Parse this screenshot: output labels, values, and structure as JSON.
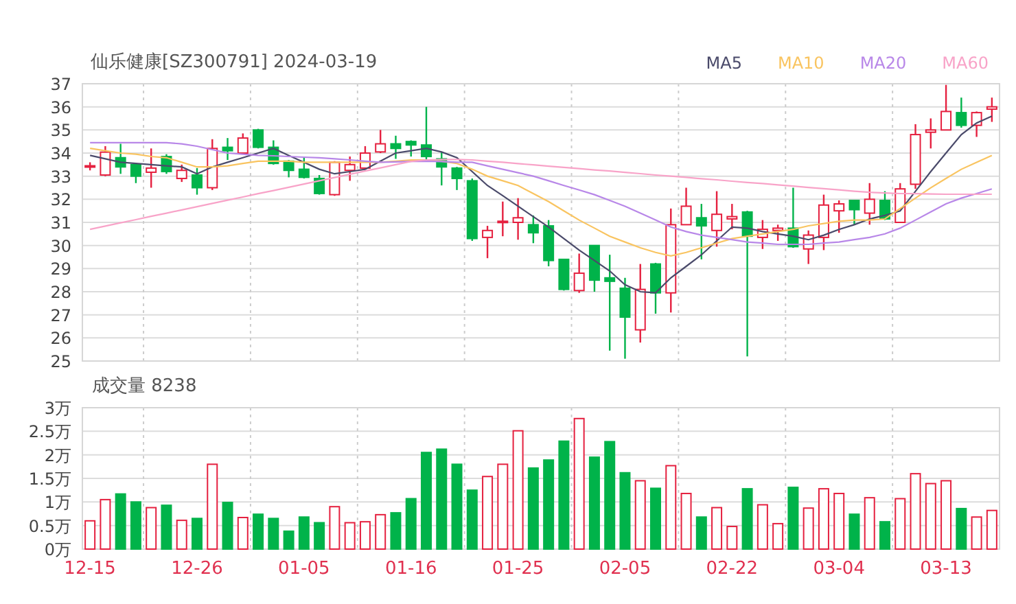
{
  "chart": {
    "title": "仙乐健康[SZ300791] 2024-03-19",
    "chart_data": {
      "type": "candlestick",
      "grid": true,
      "ylim": [
        25,
        37
      ],
      "yticks": [
        25,
        26,
        27,
        28,
        29,
        30,
        31,
        32,
        33,
        34,
        35,
        36,
        37
      ],
      "ohlc": [
        [
          33.45,
          33.6,
          33.25,
          33.45
        ],
        [
          33.05,
          34.3,
          33.0,
          34.04
        ],
        [
          33.8,
          34.4,
          33.1,
          33.4
        ],
        [
          33.5,
          33.55,
          32.7,
          33.0
        ],
        [
          33.17,
          34.2,
          32.5,
          33.35
        ],
        [
          33.85,
          33.95,
          33.1,
          33.2
        ],
        [
          32.9,
          33.5,
          32.75,
          33.25
        ],
        [
          33.05,
          33.35,
          32.2,
          32.5
        ],
        [
          32.5,
          34.6,
          32.4,
          34.2
        ],
        [
          34.25,
          34.65,
          33.7,
          34.1
        ],
        [
          34.0,
          34.85,
          33.95,
          34.65
        ],
        [
          35.0,
          35.05,
          34.2,
          34.25
        ],
        [
          34.25,
          34.55,
          33.5,
          33.55
        ],
        [
          33.65,
          33.7,
          32.95,
          33.25
        ],
        [
          33.3,
          33.85,
          32.9,
          32.95
        ],
        [
          32.9,
          33.05,
          32.2,
          32.25
        ],
        [
          32.2,
          33.65,
          32.15,
          33.6
        ],
        [
          33.25,
          33.85,
          32.8,
          33.5
        ],
        [
          33.35,
          34.3,
          33.3,
          34.0
        ],
        [
          34.05,
          35.0,
          34.0,
          34.4
        ],
        [
          34.4,
          34.75,
          33.75,
          34.2
        ],
        [
          34.5,
          34.55,
          33.85,
          34.35
        ],
        [
          34.35,
          36.0,
          33.7,
          33.85
        ],
        [
          33.75,
          34.05,
          32.6,
          33.4
        ],
        [
          33.35,
          33.4,
          32.4,
          32.9
        ],
        [
          32.8,
          32.9,
          30.2,
          30.3
        ],
        [
          30.35,
          30.85,
          29.45,
          30.65
        ],
        [
          31.0,
          31.9,
          30.4,
          31.05
        ],
        [
          31.0,
          32.05,
          30.25,
          31.2
        ],
        [
          30.9,
          31.3,
          30.1,
          30.55
        ],
        [
          30.85,
          31.1,
          29.1,
          29.35
        ],
        [
          29.4,
          29.4,
          28.05,
          28.1
        ],
        [
          28.05,
          29.65,
          27.95,
          28.8
        ],
        [
          30.0,
          30.0,
          28.0,
          28.5
        ],
        [
          28.6,
          29.6,
          25.45,
          28.45
        ],
        [
          28.15,
          28.6,
          25.1,
          26.9
        ],
        [
          26.35,
          29.2,
          25.8,
          28.1
        ],
        [
          29.2,
          29.25,
          27.05,
          27.95
        ],
        [
          27.95,
          31.6,
          27.1,
          30.9
        ],
        [
          30.9,
          32.5,
          30.9,
          31.7
        ],
        [
          31.2,
          31.8,
          29.4,
          30.85
        ],
        [
          30.65,
          32.35,
          29.95,
          31.35
        ],
        [
          31.15,
          31.8,
          30.7,
          31.25
        ],
        [
          31.45,
          31.5,
          25.2,
          30.4
        ],
        [
          30.35,
          31.1,
          29.85,
          30.7
        ],
        [
          30.65,
          30.9,
          30.2,
          30.75
        ],
        [
          30.75,
          32.5,
          29.9,
          29.95
        ],
        [
          29.85,
          30.65,
          29.2,
          30.45
        ],
        [
          30.35,
          32.2,
          29.8,
          31.75
        ],
        [
          31.5,
          31.95,
          30.55,
          31.8
        ],
        [
          31.95,
          31.95,
          30.9,
          31.55
        ],
        [
          31.4,
          32.7,
          30.9,
          32.0
        ],
        [
          31.95,
          32.35,
          31.1,
          31.15
        ],
        [
          31.0,
          32.7,
          31.0,
          32.45
        ],
        [
          32.65,
          35.25,
          32.45,
          34.8
        ],
        [
          34.9,
          35.5,
          34.2,
          35.0
        ],
        [
          35.0,
          36.95,
          35.0,
          35.8
        ],
        [
          35.75,
          36.4,
          35.1,
          35.2
        ],
        [
          35.2,
          35.8,
          34.7,
          35.75
        ],
        [
          35.9,
          36.4,
          35.35,
          36.0
        ]
      ],
      "series": [
        {
          "name": "MA5",
          "type": "line",
          "color": "#4a4a6a",
          "values": [
            33.9,
            33.75,
            33.6,
            33.55,
            33.5,
            33.45,
            33.4,
            33.1,
            33.4,
            33.6,
            33.8,
            34.0,
            34.2,
            33.9,
            33.6,
            33.3,
            33.1,
            33.2,
            33.3,
            33.65,
            34.0,
            34.1,
            34.2,
            34.05,
            33.8,
            33.2,
            32.6,
            32.15,
            31.7,
            31.25,
            30.8,
            30.3,
            29.8,
            29.35,
            28.9,
            28.3,
            28.0,
            27.95,
            28.6,
            29.1,
            29.6,
            30.2,
            30.8,
            30.75,
            30.6,
            30.5,
            30.4,
            30.25,
            30.45,
            30.7,
            30.9,
            31.15,
            31.3,
            31.5,
            32.35,
            33.2,
            34.0,
            34.8,
            35.3,
            35.6
          ]
        },
        {
          "name": "MA10",
          "type": "line",
          "color": "#f9c460",
          "values": [
            34.2,
            34.1,
            34.0,
            33.95,
            33.85,
            33.8,
            33.6,
            33.4,
            33.4,
            33.45,
            33.55,
            33.65,
            33.65,
            33.65,
            33.6,
            33.6,
            33.6,
            33.6,
            33.6,
            33.6,
            33.65,
            33.7,
            33.7,
            33.65,
            33.55,
            33.3,
            33.0,
            32.8,
            32.6,
            32.25,
            31.9,
            31.5,
            31.1,
            30.75,
            30.4,
            30.15,
            29.9,
            29.7,
            29.55,
            29.7,
            29.9,
            30.1,
            30.3,
            30.4,
            30.5,
            30.6,
            30.7,
            30.85,
            30.95,
            31.05,
            31.1,
            31.1,
            31.15,
            31.6,
            32.05,
            32.5,
            32.9,
            33.3,
            33.6,
            33.9
          ]
        },
        {
          "name": "MA20",
          "type": "line",
          "color": "#b887e8",
          "values": [
            34.45,
            34.45,
            34.45,
            34.45,
            34.45,
            34.45,
            34.4,
            34.3,
            34.15,
            34.0,
            33.95,
            33.9,
            33.88,
            33.85,
            33.82,
            33.8,
            33.75,
            33.7,
            33.65,
            33.6,
            33.62,
            33.64,
            33.65,
            33.63,
            33.6,
            33.6,
            33.45,
            33.3,
            33.15,
            33.0,
            32.8,
            32.6,
            32.4,
            32.2,
            31.95,
            31.7,
            31.4,
            31.1,
            30.8,
            30.6,
            30.45,
            30.35,
            30.25,
            30.15,
            30.1,
            30.05,
            30.05,
            30.05,
            30.1,
            30.15,
            30.25,
            30.35,
            30.5,
            30.75,
            31.1,
            31.45,
            31.8,
            32.05,
            32.25,
            32.45
          ]
        },
        {
          "name": "MA60",
          "type": "line",
          "color": "#f8a3c8",
          "values": [
            30.7,
            30.84,
            30.98,
            31.12,
            31.26,
            31.4,
            31.54,
            31.68,
            31.82,
            31.96,
            32.1,
            32.24,
            32.38,
            32.52,
            32.66,
            32.8,
            32.94,
            33.08,
            33.22,
            33.36,
            33.5,
            33.64,
            33.7,
            33.72,
            33.72,
            33.7,
            33.65,
            33.6,
            33.54,
            33.49,
            33.43,
            33.38,
            33.33,
            33.27,
            33.22,
            33.16,
            33.11,
            33.05,
            33.0,
            32.95,
            32.89,
            32.84,
            32.78,
            32.73,
            32.68,
            32.62,
            32.57,
            32.51,
            32.46,
            32.41,
            32.35,
            32.3,
            32.27,
            32.25,
            32.24,
            32.23,
            32.22,
            32.22,
            32.22,
            32.22
          ]
        }
      ]
    }
  },
  "volume": {
    "title": "成交量 8238",
    "chart_data": {
      "type": "bar",
      "grid": true,
      "categories": [
        "12-15",
        null,
        null,
        null,
        null,
        null,
        null,
        "12-26",
        null,
        null,
        null,
        null,
        null,
        null,
        "01-05",
        null,
        null,
        null,
        null,
        null,
        null,
        "01-16",
        null,
        null,
        null,
        null,
        null,
        null,
        "01-25",
        null,
        null,
        null,
        null,
        null,
        null,
        "02-05",
        null,
        null,
        null,
        null,
        null,
        null,
        "02-22",
        null,
        null,
        null,
        null,
        null,
        null,
        "03-04",
        null,
        null,
        null,
        null,
        null,
        null,
        "03-13",
        null,
        null,
        null
      ],
      "ylim": [
        0,
        3
      ],
      "yticks": [
        {
          "value": 0,
          "label": "0万"
        },
        {
          "value": 0.5,
          "label": "0.5万"
        },
        {
          "value": 1,
          "label": "1万"
        },
        {
          "value": 1.5,
          "label": "1.5万"
        },
        {
          "value": 2,
          "label": "2万"
        },
        {
          "value": 2.5,
          "label": "2.5万"
        },
        {
          "value": 3,
          "label": "3万"
        }
      ],
      "values": [
        0.6,
        1.05,
        1.17,
        1.0,
        0.88,
        0.93,
        0.61,
        0.65,
        1.8,
        0.99,
        0.67,
        0.74,
        0.65,
        0.38,
        0.68,
        0.56,
        0.9,
        0.56,
        0.58,
        0.73,
        0.77,
        1.07,
        2.05,
        2.12,
        1.8,
        1.25,
        1.54,
        1.8,
        2.51,
        1.72,
        1.89,
        2.29,
        2.77,
        1.95,
        2.28,
        1.62,
        1.45,
        1.29,
        1.77,
        1.18,
        0.68,
        0.88,
        0.48,
        1.28,
        0.94,
        0.54,
        1.31,
        0.87,
        1.28,
        1.18,
        0.74,
        1.09,
        0.58,
        1.07,
        1.6,
        1.39,
        1.45,
        0.86,
        0.68,
        0.82
      ]
    }
  }
}
